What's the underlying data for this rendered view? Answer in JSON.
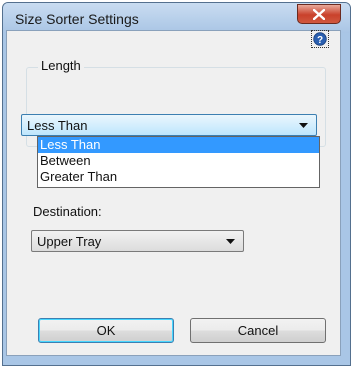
{
  "window": {
    "title": "Size Sorter Settings"
  },
  "icons": {
    "close": "close-icon",
    "help": "help-icon",
    "dropdown": "chevron-down-icon"
  },
  "length": {
    "group_label": "Length",
    "selected": "Less Than",
    "options": [
      "Less Than",
      "Between",
      "Greater Than"
    ]
  },
  "destination": {
    "label": "Destination:",
    "selected": "Upper Tray"
  },
  "buttons": {
    "ok": "OK",
    "cancel": "Cancel"
  },
  "colors": {
    "accent": "#3399ff",
    "close": "#c9412b"
  }
}
